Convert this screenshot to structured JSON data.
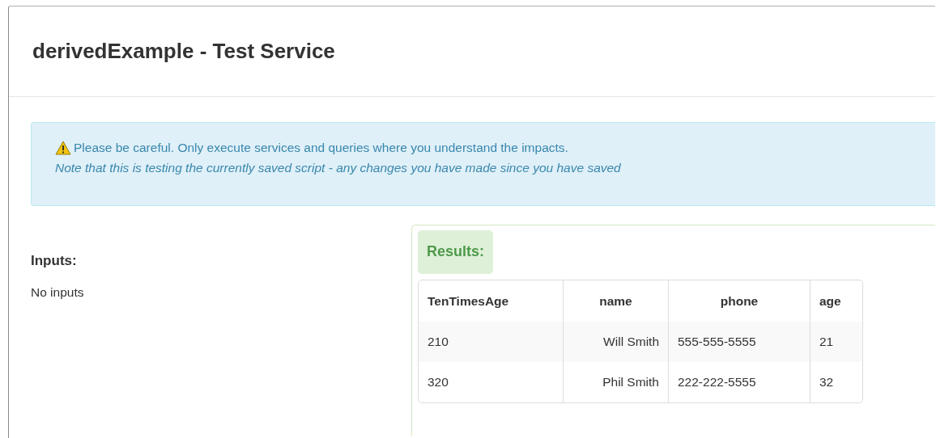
{
  "dialog": {
    "title": "derivedExample - Test Service"
  },
  "alert": {
    "message": "Please be careful. Only execute services and queries where you understand the impacts.",
    "note": "Note that this is testing the currently saved script - any changes you have made since you have saved"
  },
  "inputs": {
    "heading": "Inputs:",
    "empty_text": "No inputs"
  },
  "results": {
    "heading": "Results:",
    "columns": [
      "TenTimesAge",
      "name",
      "phone",
      "age"
    ],
    "rows": [
      [
        "210",
        "Will Smith",
        "555-555-5555",
        "21"
      ],
      [
        "320",
        "Phil Smith",
        "222-222-5555",
        "32"
      ]
    ]
  }
}
